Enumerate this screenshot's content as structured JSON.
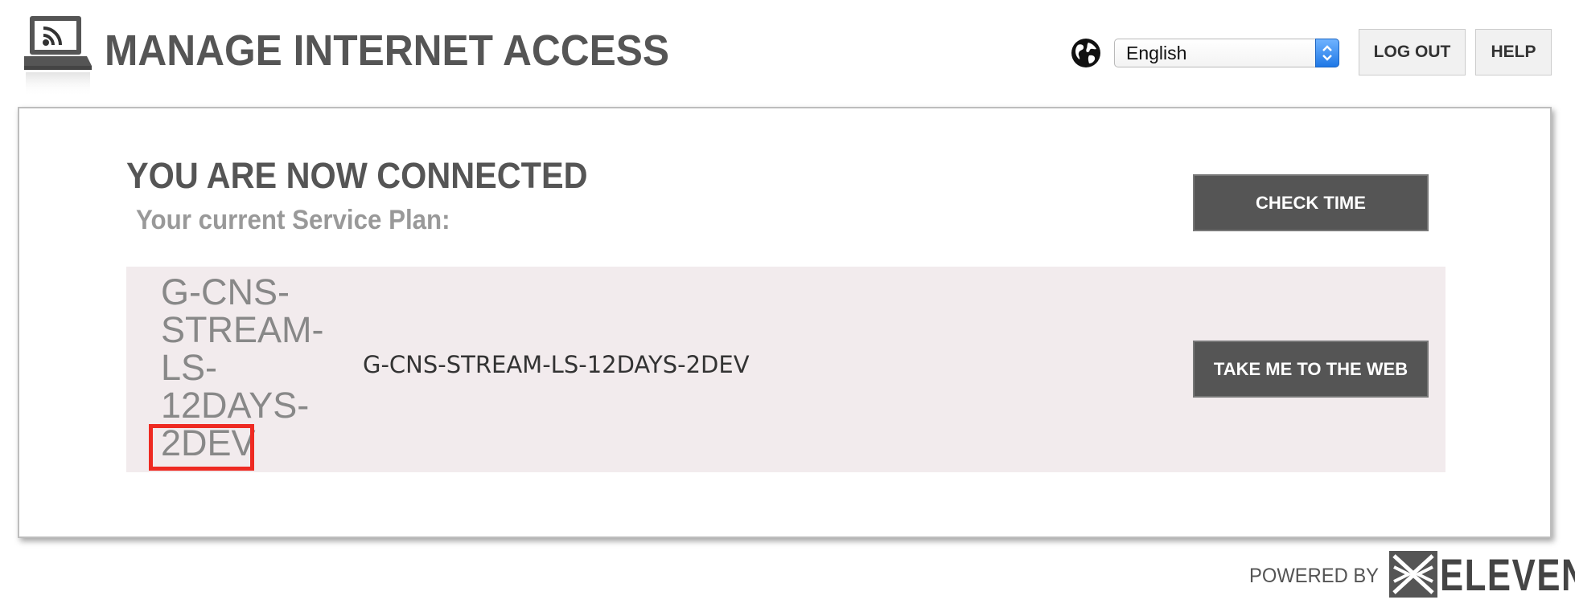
{
  "header": {
    "title": "MANAGE INTERNET ACCESS",
    "logo_icon": "laptop-wifi-icon",
    "language_icon": "globe-icon",
    "language": {
      "selected": "English"
    },
    "logout_label": "LOG OUT",
    "help_label": "HELP"
  },
  "main": {
    "title": "YOU ARE NOW CONNECTED",
    "plan_label": "Your current Service Plan:",
    "check_time_label": "CHECK TIME",
    "plan": {
      "name_wrapped": [
        "G-CNS-",
        "STREAM-",
        "LS-",
        "12DAYS-",
        "2DEV"
      ],
      "name": "G-CNS-STREAM-LS-12DAYS-2DEV"
    },
    "take_me_label": "TAKE ME TO THE WEB",
    "highlight_color": "#EE2A22"
  },
  "footer": {
    "powered_by": "POWERED BY",
    "brand": "ELEVEN"
  },
  "colors": {
    "title_gray": "#555555",
    "subtitle_gray": "#999999",
    "row_background": "#F2EBED",
    "dark_button": "#555555"
  }
}
